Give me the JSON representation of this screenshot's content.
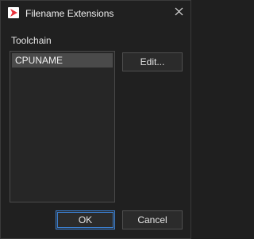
{
  "window": {
    "title": "Filename Extensions",
    "close_icon": "close-icon",
    "app_icon": "app-logo-icon",
    "accent_color": "#3b7fd0",
    "logo_color": "#e8323c"
  },
  "toolchain": {
    "label": "Toolchain",
    "items": [
      {
        "label": "CPUNAME",
        "selected": true
      }
    ],
    "edit_label": "Edit..."
  },
  "footer": {
    "ok_label": "OK",
    "cancel_label": "Cancel"
  }
}
